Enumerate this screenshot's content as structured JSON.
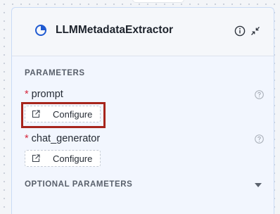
{
  "node": {
    "title": "LLMMetadataExtractor",
    "icons": {
      "component": "pie-chart-icon",
      "info": "info-icon",
      "collapse": "collapse-arrows-icon"
    }
  },
  "parameters": {
    "section_title": "PARAMETERS",
    "items": [
      {
        "name": "prompt",
        "required_marker": "*",
        "help_icon": "question-circle-icon",
        "button_label": "Configure",
        "button_icon": "external-link-icon"
      },
      {
        "name": "chat_generator",
        "required_marker": "*",
        "help_icon": "question-circle-icon",
        "button_label": "Configure",
        "button_icon": "external-link-icon"
      }
    ]
  },
  "optional_parameters": {
    "section_title": "OPTIONAL PARAMETERS",
    "toggle_icon": "caret-down-icon"
  },
  "colors": {
    "required_marker": "#d7263d",
    "highlight": "#a7251c",
    "accent": "#1f5ad1",
    "card_border": "#c9dbf6"
  }
}
